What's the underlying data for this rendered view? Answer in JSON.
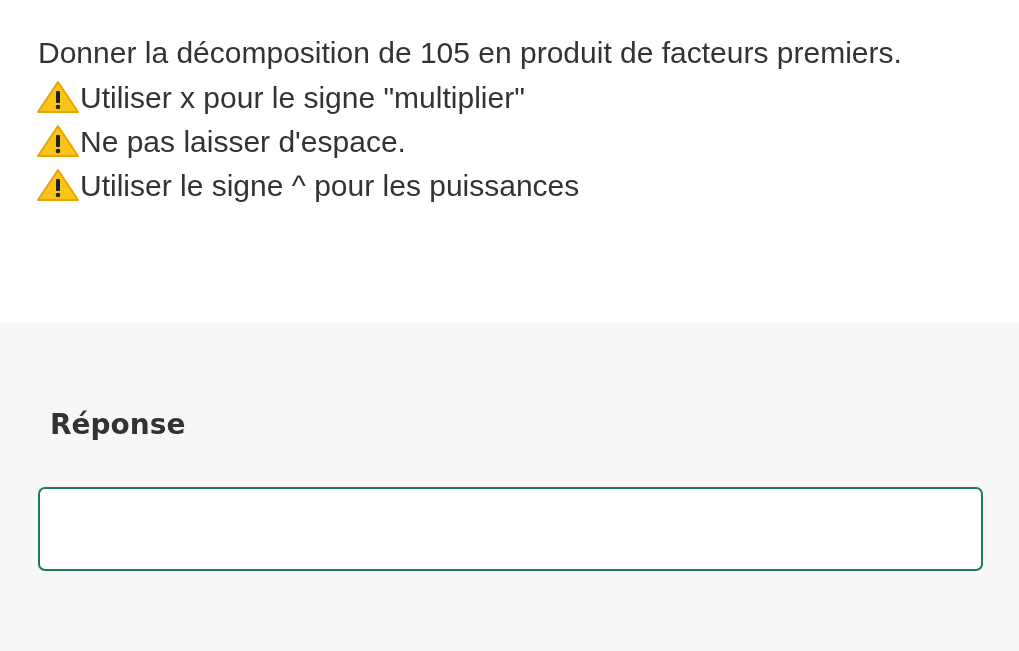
{
  "question": {
    "text": "Donner la décomposition de 105 en produit de facteurs premiers.",
    "warnings": [
      {
        "text": "Utiliser x pour le signe \"multiplier\""
      },
      {
        "text": "Ne pas laisser d'espace."
      },
      {
        "text": "Utiliser le signe ^ pour les puissances"
      }
    ]
  },
  "answer": {
    "label": "Réponse"
  }
}
